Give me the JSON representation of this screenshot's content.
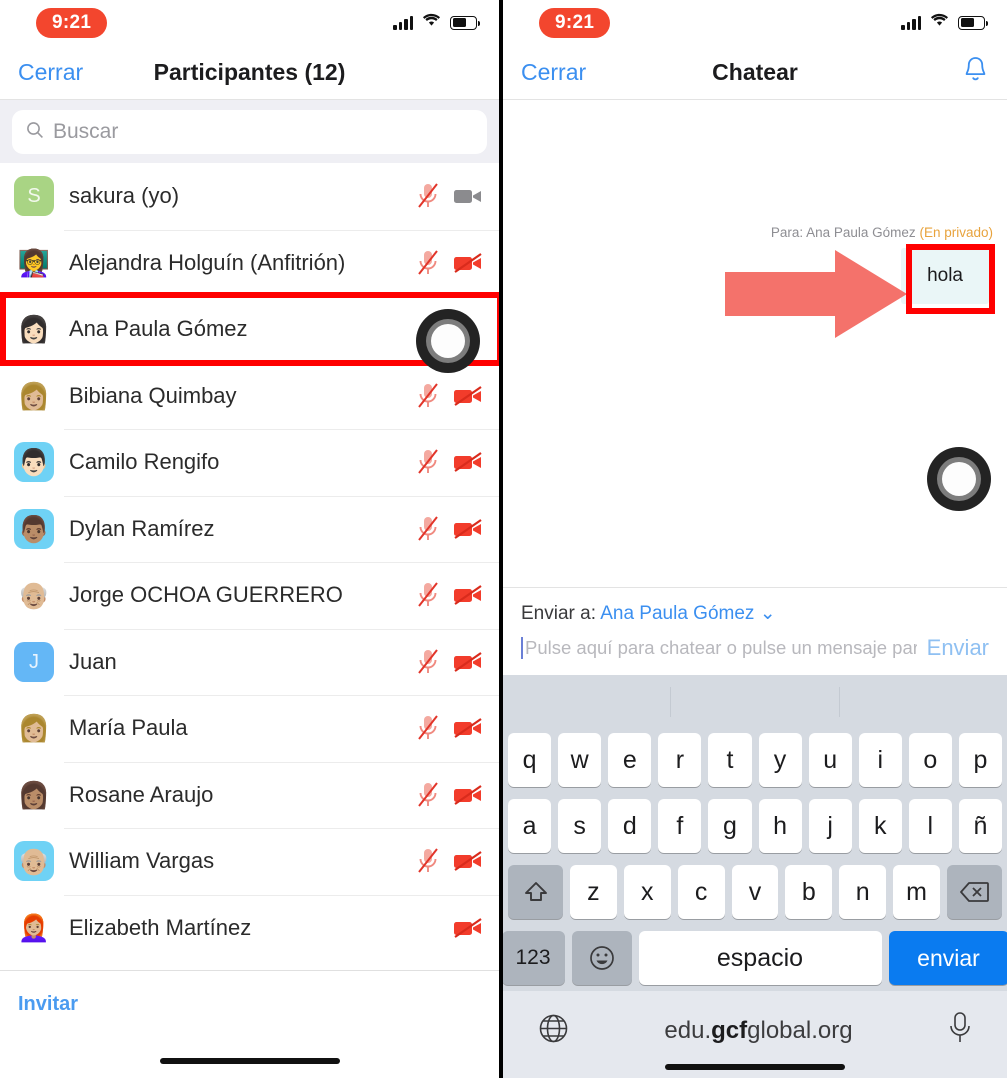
{
  "status_bar": {
    "time": "9:21",
    "signal_icon": "cellular-signal-icon",
    "wifi_icon": "wifi-icon",
    "battery_icon": "battery-icon"
  },
  "left_panel": {
    "nav": {
      "close_label": "Cerrar",
      "title": "Participantes (12)"
    },
    "search": {
      "placeholder": "Buscar",
      "icon": "search-icon"
    },
    "participants": [
      {
        "name": "sakura (yo)",
        "avatar_glyph": "S",
        "avatar_type": "initial",
        "avatar_color": "#a9d484",
        "mic": "muted",
        "cam": "off-gray"
      },
      {
        "name": "Alejandra Holguín (Anfitrión)",
        "avatar_glyph": "👩‍🏫",
        "avatar_type": "emoji",
        "avatar_color": "#ffffff",
        "mic": "muted",
        "cam": "off-red"
      },
      {
        "name": "Ana Paula Gómez",
        "avatar_glyph": "👩🏻",
        "avatar_type": "emoji",
        "avatar_color": "#ffffff",
        "mic": "none",
        "cam": "none"
      },
      {
        "name": "Bibiana Quimbay",
        "avatar_glyph": "👩🏼",
        "avatar_type": "emoji",
        "avatar_color": "#ffffff",
        "mic": "muted",
        "cam": "off-red"
      },
      {
        "name": "Camilo Rengifo",
        "avatar_glyph": "👨🏻",
        "avatar_type": "emoji",
        "avatar_color": "#6fd2f5",
        "mic": "muted",
        "cam": "off-red"
      },
      {
        "name": "Dylan Ramírez",
        "avatar_glyph": "👨🏽",
        "avatar_type": "emoji",
        "avatar_color": "#6fd2f5",
        "mic": "muted",
        "cam": "off-red"
      },
      {
        "name": "Jorge OCHOA GUERRERO",
        "avatar_glyph": "👴🏼",
        "avatar_type": "emoji",
        "avatar_color": "#ffffff",
        "mic": "muted",
        "cam": "off-red"
      },
      {
        "name": "Juan",
        "avatar_glyph": "J",
        "avatar_type": "initial",
        "avatar_color": "#64b7f6",
        "mic": "muted",
        "cam": "off-red"
      },
      {
        "name": "María Paula",
        "avatar_glyph": "👩🏼",
        "avatar_type": "emoji",
        "avatar_color": "#ffffff",
        "mic": "muted",
        "cam": "off-red"
      },
      {
        "name": "Rosane Araujo",
        "avatar_glyph": "👩🏽",
        "avatar_type": "emoji",
        "avatar_color": "#ffffff",
        "mic": "muted",
        "cam": "off-red"
      },
      {
        "name": "William Vargas",
        "avatar_glyph": "👴🏼",
        "avatar_type": "emoji",
        "avatar_color": "#6fd2f5",
        "mic": "muted",
        "cam": "off-red"
      },
      {
        "name": "Elizabeth Martínez",
        "avatar_glyph": "👩🏼‍🦰",
        "avatar_type": "emoji",
        "avatar_color": "#ffffff",
        "mic": "none",
        "cam": "off-red"
      }
    ],
    "selected_participant_index": 2,
    "footer": {
      "invite_label": "Invitar"
    }
  },
  "right_panel": {
    "nav": {
      "close_label": "Cerrar",
      "title": "Chatear",
      "bell_icon": "bell-icon"
    },
    "message": {
      "recipient_prefix": "Para:",
      "recipient": "Ana Paula Gómez",
      "privacy_tag": "(En privado)",
      "text": "hola"
    },
    "send_to": {
      "label": "Enviar a:",
      "recipient": "Ana Paula Gómez",
      "chevron_icon": "chevron-down-icon"
    },
    "composer": {
      "placeholder": "Pulse aquí para chatear o pulse un mensaje para r...",
      "send_label": "Enviar"
    },
    "keyboard": {
      "row1": [
        "q",
        "w",
        "e",
        "r",
        "t",
        "y",
        "u",
        "i",
        "o",
        "p"
      ],
      "row2": [
        "a",
        "s",
        "d",
        "f",
        "g",
        "h",
        "j",
        "k",
        "l",
        "ñ"
      ],
      "row3": [
        "z",
        "x",
        "c",
        "v",
        "b",
        "n",
        "m"
      ],
      "shift_icon": "shift-icon",
      "backspace_icon": "backspace-icon",
      "numbers_label": "123",
      "emoji_icon": "emoji-icon",
      "space_label": "espacio",
      "return_label": "enviar"
    },
    "browser_bar": {
      "globe_icon": "globe-icon",
      "url_prefix": "edu.",
      "url_bold": "gcf",
      "url_suffix": "global.org",
      "mic_icon": "microphone-icon"
    }
  },
  "annotations": {
    "arrow_color": "#f4726b",
    "highlight_color": "#ff0000",
    "arrow_icon": "right-arrow-annotation",
    "highlight_name": "red-highlight-box"
  }
}
